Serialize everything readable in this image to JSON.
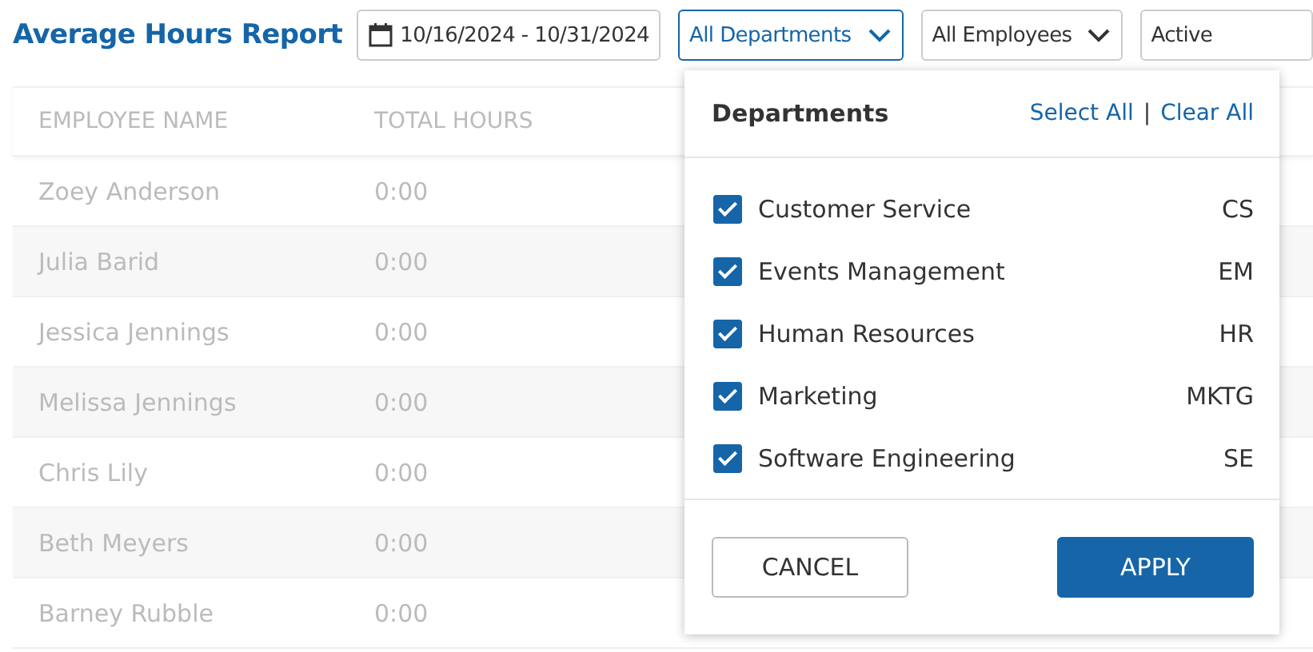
{
  "title": "Average Hours Report",
  "filters": {
    "date_range": "10/16/2024 - 10/31/2024",
    "department": {
      "value": "All Departments",
      "open": true
    },
    "employee": "All Employees",
    "status": "Active"
  },
  "table": {
    "columns": [
      "EMPLOYEE NAME",
      "TOTAL HOURS"
    ],
    "rows": [
      {
        "name": "Zoey Anderson",
        "total_hours": "0:00"
      },
      {
        "name": "Julia Barid",
        "total_hours": "0:00"
      },
      {
        "name": "Jessica Jennings",
        "total_hours": "0:00"
      },
      {
        "name": "Melissa Jennings",
        "total_hours": "0:00"
      },
      {
        "name": "Chris Lily",
        "total_hours": "0:00"
      },
      {
        "name": "Beth Meyers",
        "total_hours": "0:00"
      },
      {
        "name": "Barney Rubble",
        "total_hours": "0:00"
      }
    ]
  },
  "dropdown": {
    "title": "Departments",
    "select_all": "Select All",
    "divider": "|",
    "clear_all": "Clear All",
    "items": [
      {
        "label": "Customer Service",
        "code": "CS",
        "checked": true
      },
      {
        "label": "Events Management",
        "code": "EM",
        "checked": true
      },
      {
        "label": "Human Resources",
        "code": "HR",
        "checked": true
      },
      {
        "label": "Marketing",
        "code": "MKTG",
        "checked": true
      },
      {
        "label": "Software Engineering",
        "code": "SE",
        "checked": true
      }
    ],
    "buttons": [
      {
        "label": "CANCEL",
        "kind": "secondary"
      },
      {
        "label": "APPLY",
        "kind": "primary"
      }
    ]
  }
}
